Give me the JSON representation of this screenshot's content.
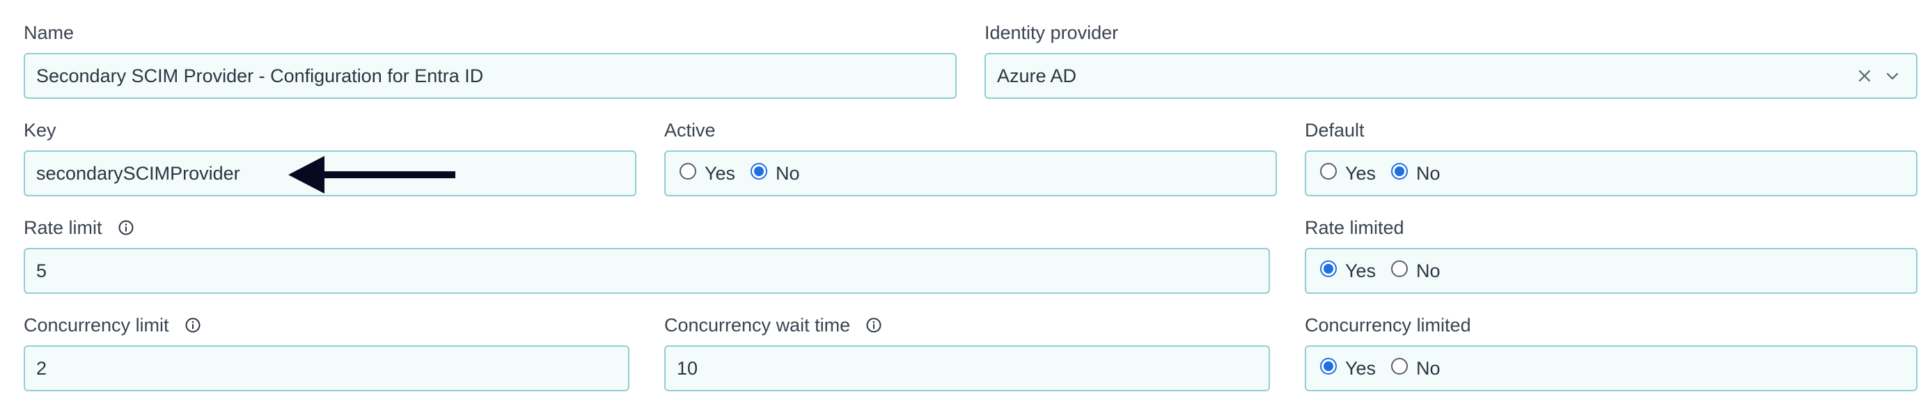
{
  "fields": {
    "name": {
      "label": "Name",
      "value": "Secondary SCIM Provider - Configuration for Entra ID"
    },
    "identity_provider": {
      "label": "Identity provider",
      "value": "Azure AD"
    },
    "key": {
      "label": "Key",
      "value": "secondarySCIMProvider"
    },
    "active": {
      "label": "Active",
      "options": [
        "Yes",
        "No"
      ],
      "selected": "No"
    },
    "default": {
      "label": "Default",
      "options": [
        "Yes",
        "No"
      ],
      "selected": "No"
    },
    "rate_limit": {
      "label": "Rate limit",
      "value": "5",
      "icon": "info-icon"
    },
    "rate_limited": {
      "label": "Rate limited",
      "options": [
        "Yes",
        "No"
      ],
      "selected": "Yes"
    },
    "concurrency_limit": {
      "label": "Concurrency limit",
      "value": "2",
      "icon": "info-icon"
    },
    "concurrency_wait_time": {
      "label": "Concurrency wait time",
      "value": "10",
      "icon": "info-icon"
    },
    "concurrency_limited": {
      "label": "Concurrency limited",
      "options": [
        "Yes",
        "No"
      ],
      "selected": "Yes"
    }
  },
  "icons": {
    "clear": "close-icon",
    "chevron": "chevron-down-icon",
    "annotation": "arrow-left-icon"
  },
  "colors": {
    "field_border": "#8fcfd3",
    "field_bg": "#f4fbfb",
    "radio_checked": "#1f6fe0",
    "text": "#2b3440"
  }
}
